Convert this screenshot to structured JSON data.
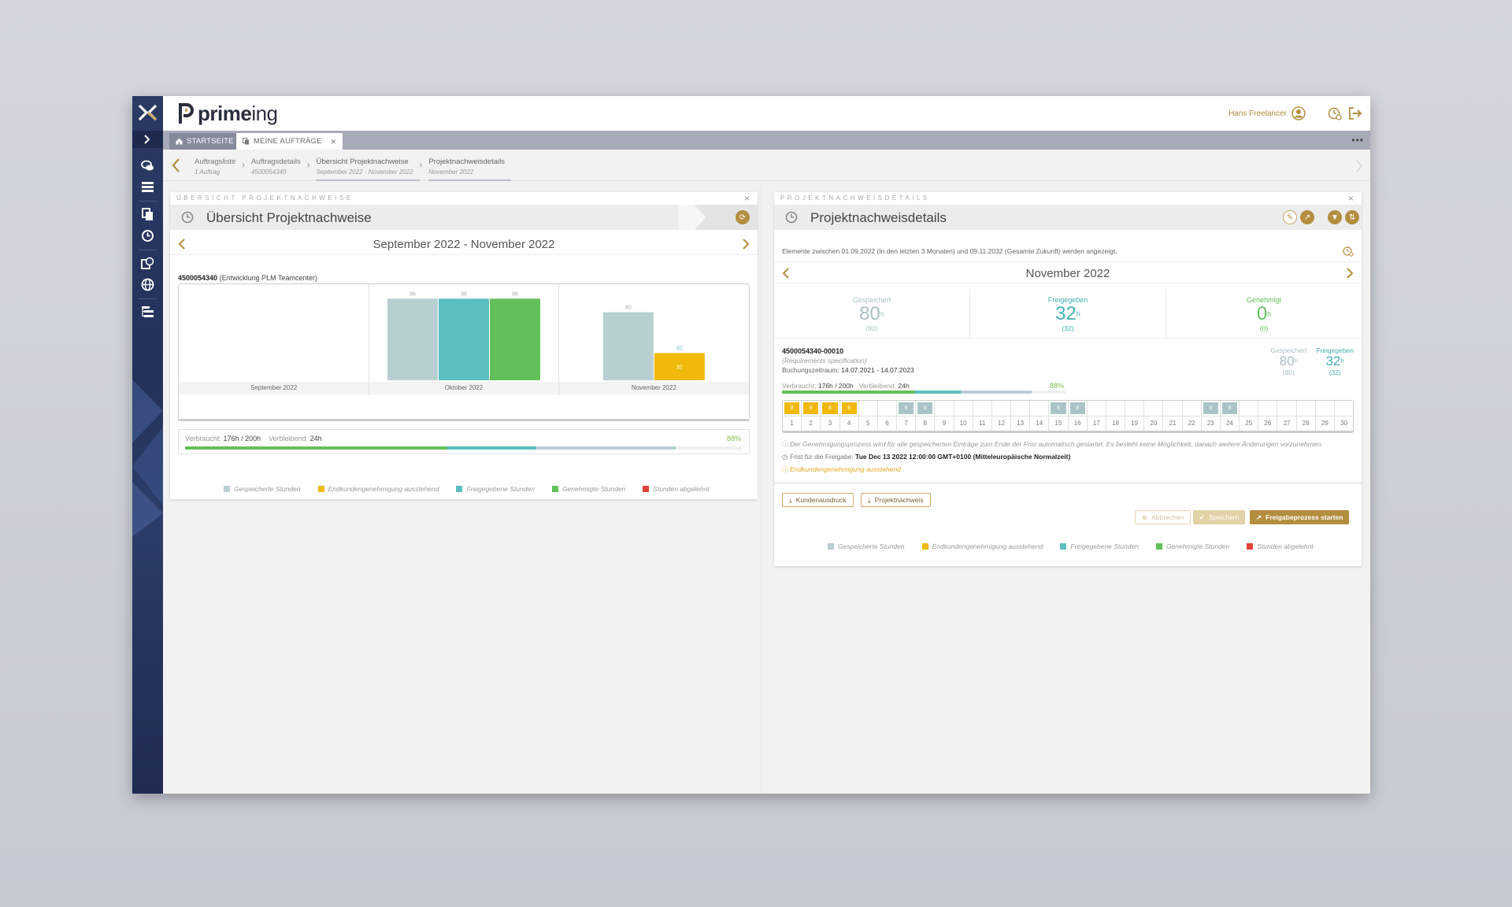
{
  "header": {
    "brand_prefix": "prime",
    "brand_suffix": "ing",
    "user_name": "Hans Freelancer"
  },
  "tabs": [
    {
      "label": "STARTSEITE",
      "icon": "home-icon"
    },
    {
      "label": "MEINE AUFTRÄGE",
      "icon": "documents-icon"
    }
  ],
  "breadcrumb": [
    {
      "label": "Auftragsliste",
      "sub": "1 Auftrag"
    },
    {
      "label": "Auftragsdetails",
      "sub": "4500054340"
    },
    {
      "label": "Übersicht Projektnachweise",
      "sub": "September 2022 - November 2022"
    },
    {
      "label": "Projektnachweisdetails",
      "sub": "November 2022"
    }
  ],
  "left_panel": {
    "caption": "ÜBERSICHT PROJEKTNACHWEISE",
    "title": "Übersicht Projektnachweise",
    "period": "September 2022 - November 2022",
    "order_number": "4500054340",
    "order_desc": "(Entwicklung PLM Teamcenter)",
    "usage_label": "Verbraucht:",
    "usage_value": "176h / 200h",
    "remaining_label": "Verbleibend:",
    "remaining_value": "24h",
    "percent": "88%",
    "usage_fractions": {
      "approved": 0.47,
      "released": 0.63,
      "saved": 0.88
    }
  },
  "chart_data": {
    "type": "bar",
    "categories": [
      "September 2022",
      "Oktober 2022",
      "November 2022"
    ],
    "series": [
      {
        "name": "Gespeicherte Stunden",
        "color": "#b8cfd2",
        "values": [
          0,
          96,
          80
        ]
      },
      {
        "name": "Freigegebene Stunden",
        "color": "#5bbfc0",
        "values": [
          0,
          96,
          0
        ]
      },
      {
        "name": "Genehmigte Stunden",
        "color": "#62c05a",
        "values": [
          0,
          96,
          0
        ]
      },
      {
        "name": "Endkundengenehmigung ausstehend",
        "color": "#f0b90b",
        "values": [
          0,
          0,
          32
        ]
      }
    ],
    "ylim": [
      0,
      100
    ]
  },
  "legend": [
    {
      "label": "Gespeicherte Stunden",
      "color": "#b8cfd2"
    },
    {
      "label": "Endkundengenehmigung ausstehend",
      "color": "#f0b90b"
    },
    {
      "label": "Freigegebene Stunden",
      "color": "#5bbfc0"
    },
    {
      "label": "Genehmigte Stunden",
      "color": "#62c05a"
    },
    {
      "label": "Stunden abgelehnt",
      "color": "#e0413a"
    }
  ],
  "right_panel": {
    "caption": "PROJEKTNACHWEISDETAILS",
    "title": "Projektnachweisdetails",
    "info": "Elemente zwischen 01.09.2022 (In den letzten 3 Monaten) und 09.11.2032 (Gesamte Zukunft) werden angezeigt.",
    "period": "November 2022",
    "stats": [
      {
        "label": "Gespeichert",
        "value": "80",
        "unit": "h",
        "sub": "(80)",
        "color": "#a9bfc2"
      },
      {
        "label": "Freigegeben",
        "value": "32",
        "unit": "h",
        "sub": "(32)",
        "color": "#44b0b3"
      },
      {
        "label": "Genehmigt",
        "value": "0",
        "unit": "h",
        "sub": "(0)",
        "color": "#62c05a"
      }
    ],
    "position": {
      "id": "4500054340-00010",
      "desc": "(Requirements specification)",
      "period_label": "Buchungszeitraum:",
      "period_value": "14.07.2021 - 14.07.2023",
      "used_label": "Verbraucht:",
      "used_value": "176h / 200h",
      "remaining_label": "Verbleibend:",
      "remaining_value": "24h",
      "percent": "88%",
      "mini": [
        {
          "label": "Gespeichert",
          "value": "80",
          "unit": "h",
          "sub": "(80)",
          "color": "#a9bfc2"
        },
        {
          "label": "Freigegeben",
          "value": "32",
          "unit": "h",
          "sub": "(32)",
          "color": "#44b0b3"
        }
      ]
    },
    "days": [
      {
        "n": "1",
        "h": "8",
        "s": "pending"
      },
      {
        "n": "2",
        "h": "8",
        "s": "pending"
      },
      {
        "n": "3",
        "h": "8",
        "s": "pending"
      },
      {
        "n": "4",
        "h": "8",
        "s": "pending"
      },
      {
        "n": "5"
      },
      {
        "n": "6"
      },
      {
        "n": "7",
        "h": "8",
        "s": "saved"
      },
      {
        "n": "8",
        "h": "8",
        "s": "saved"
      },
      {
        "n": "9"
      },
      {
        "n": "10"
      },
      {
        "n": "11"
      },
      {
        "n": "12"
      },
      {
        "n": "13"
      },
      {
        "n": "14"
      },
      {
        "n": "15",
        "h": "8",
        "s": "saved"
      },
      {
        "n": "16",
        "h": "8",
        "s": "saved"
      },
      {
        "n": "17"
      },
      {
        "n": "18"
      },
      {
        "n": "19"
      },
      {
        "n": "20"
      },
      {
        "n": "21"
      },
      {
        "n": "22"
      },
      {
        "n": "23",
        "h": "8",
        "s": "saved"
      },
      {
        "n": "24",
        "h": "8",
        "s": "saved"
      },
      {
        "n": "25"
      },
      {
        "n": "26"
      },
      {
        "n": "27"
      },
      {
        "n": "28"
      },
      {
        "n": "29"
      },
      {
        "n": "30"
      }
    ],
    "note_auto": "Der Genehmigungsprozess wird für alle gespeicherten Einträge zum Ende der Frist automatisch gestartet. Es besteht keine Möglichkeit, danach weitere Änderungen vorzunehmen.",
    "deadline_label": "Frist für die Freigabe:",
    "deadline_value": "Tue Dec 13 2022 12:00:00 GMT+0100 (Mitteleuropäische Normalzeit)",
    "note_pending": "Endkundengenehmigung ausstehend",
    "buttons": {
      "customer_print": "Kundenausdruck",
      "project_proof": "Projektnachweis",
      "cancel": "Abbrechen",
      "save": "Speichern",
      "start_release": "Freigabeprozess starten"
    }
  },
  "colors": {
    "accent": "#b48e3f",
    "rail": "#2b3a63",
    "pending": "#f0b90b",
    "saved": "#a9c4c7"
  }
}
